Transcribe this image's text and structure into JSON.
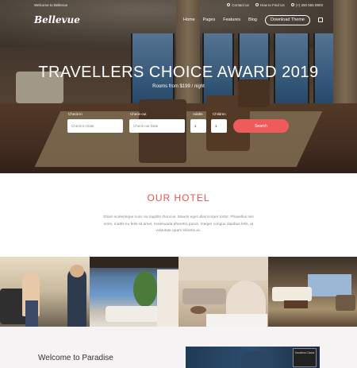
{
  "topbar": {
    "welcome": "Welcome to Bellevue",
    "contact_us": "Contact us",
    "find_us": "How to Find Us",
    "phone": "(+) 250 555 8903"
  },
  "nav": {
    "logo": "Bellevue",
    "items": [
      "Home",
      "Pages",
      "Features",
      "Blog"
    ],
    "download": "Download Theme"
  },
  "hero": {
    "title": "TRAVELLERS CHOICE AWARD 2019",
    "subtitle": "Rooms from $199 / night",
    "checkin_label": "Check-in",
    "checkin_placeholder": "Check-in Date",
    "checkout_label": "Check-out",
    "checkout_placeholder": "Check-out Date",
    "adults_label": "Adults",
    "adults_value": "1",
    "children_label": "Children",
    "children_value": "1",
    "search": "Search"
  },
  "our_hotel": {
    "title": "OUR HOTEL",
    "text": "Etiam scelerisque nunc eu sagittis rhoncus. Mauris eget ullamcorper tortor. Phasellus nisi enim, mattis eu felis sit amet, malesuada pharetra purus. Integer congue dapibus felis, at vulputate quam lobortis ac."
  },
  "welcome_section": {
    "title": "Welcome to Paradise",
    "badge": "Travellers Choice"
  },
  "icons": [
    "chat-icon",
    "location-icon",
    "phone-icon",
    "shopping-bag-icon"
  ],
  "colors": {
    "accent": "#ef5b5b",
    "title_red": "#e2574c"
  }
}
